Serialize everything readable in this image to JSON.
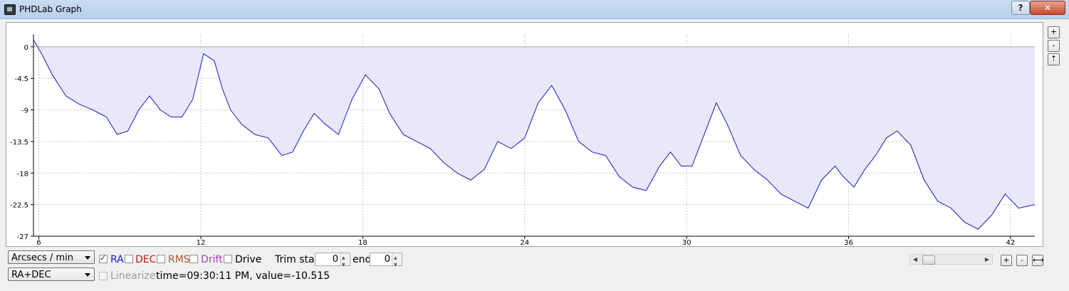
{
  "window": {
    "title": "PHDLab Graph",
    "help_label": "?",
    "close_label": "✕"
  },
  "side_buttons": {
    "zoom_in": "+",
    "zoom_out": "-",
    "reset": "⇡"
  },
  "controls": {
    "units_select": "Arcsecs / min",
    "mode_select": "RA+DEC",
    "ra_label": "RA",
    "dec_label": "DEC",
    "rms_label": "RMS",
    "drift_label": "Drift",
    "drive_label": "Drive",
    "linearize_label": "Linearize",
    "trim_start_label": "Trim star",
    "trim_start_value": "0",
    "trim_end_label": "end",
    "trim_end_value": "0",
    "status": "time=09:30:11 PM, value=-10.515",
    "ra_checked": true,
    "dec_checked": false,
    "rms_checked": false,
    "drift_checked": false,
    "drive_checked": false,
    "linearize_checked": false,
    "zoom_in": "+",
    "zoom_out": "-",
    "fit": "⟷"
  },
  "colors": {
    "ra": "#1a1ac8",
    "dec": "#c81a1a",
    "rms": "#b05a28",
    "drift": "#b03cc8",
    "fill": "#e8e8f8"
  },
  "chart_data": {
    "type": "area",
    "xlim": [
      5.8,
      42.9
    ],
    "ylim": [
      -27,
      1.8
    ],
    "xticks": [
      6,
      12,
      18,
      24,
      30,
      36,
      42
    ],
    "yticks": [
      0,
      -4.5,
      -9,
      -13.5,
      -18,
      -22.5,
      -27
    ],
    "ytick_labels": [
      "0",
      "-4.5",
      "-9",
      "-13.5",
      "-18",
      "-22.5",
      "-27"
    ],
    "grid": true,
    "series": [
      {
        "x": [
          5.8,
          6.1,
          6.5,
          7.0,
          7.5,
          8.0,
          8.5,
          8.9,
          9.3,
          9.7,
          10.1,
          10.5,
          10.9,
          11.3,
          11.7,
          12.1,
          12.5,
          12.8,
          13.1,
          13.5,
          14.0,
          14.5,
          15.0,
          15.4,
          15.8,
          16.2,
          16.6,
          17.1,
          17.6,
          18.1,
          18.6,
          19.0,
          19.5,
          20.0,
          20.5,
          21.0,
          21.5,
          22.0,
          22.5,
          23.0,
          23.5,
          24.0,
          24.5,
          25.0,
          25.5,
          26.0,
          26.5,
          27.0,
          27.5,
          28.0,
          28.5,
          29.0,
          29.4,
          29.8,
          30.2,
          30.6,
          31.1,
          31.5,
          32.0,
          32.5,
          33.0,
          33.5,
          34.0,
          34.5,
          35.0,
          35.5,
          35.8,
          36.2,
          36.6,
          37.0,
          37.4,
          37.8,
          38.3,
          38.8,
          39.3,
          39.8,
          40.3,
          40.8,
          41.3,
          41.8,
          42.3,
          42.9
        ],
        "values": [
          1.0,
          -1.0,
          -4.0,
          -7.0,
          -8.2,
          -9.0,
          -10.0,
          -12.5,
          -12.0,
          -9.0,
          -7.0,
          -9.0,
          -10.0,
          -10.0,
          -7.5,
          -1.0,
          -2.0,
          -6.0,
          -9.0,
          -11.0,
          -12.5,
          -13.0,
          -15.5,
          -15.0,
          -12.0,
          -9.5,
          -11.0,
          -12.5,
          -7.5,
          -4.0,
          -6.0,
          -9.5,
          -12.5,
          -13.5,
          -14.5,
          -16.5,
          -18.0,
          -19.0,
          -17.5,
          -13.5,
          -14.5,
          -13.0,
          -8.0,
          -5.5,
          -9.0,
          -13.5,
          -15.0,
          -15.5,
          -18.5,
          -20.0,
          -20.5,
          -17.0,
          -15.0,
          -17.0,
          -17.0,
          -13.0,
          -8.0,
          -11.0,
          -15.5,
          -17.5,
          -19.0,
          -21.0,
          -22.0,
          -23.0,
          -19.0,
          -17.0,
          -18.5,
          -20.0,
          -17.5,
          -15.5,
          -13.0,
          -12.0,
          -14.0,
          -19.0,
          -22.0,
          -23.0,
          -25.0,
          -26.0,
          -24.0,
          -21.0,
          -23.0,
          -22.5
        ]
      }
    ]
  }
}
